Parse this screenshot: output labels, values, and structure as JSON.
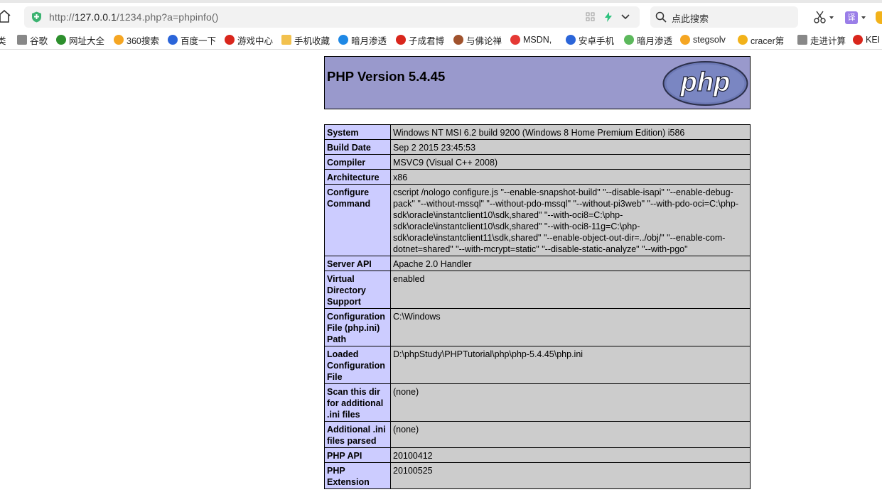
{
  "browser": {
    "url_prefix": "http://",
    "url_host": "127.0.0.1",
    "url_path": "/1234.php?a=phpinfo()",
    "search_placeholder": "点此搜索",
    "translate_label": "译"
  },
  "bookmarks": [
    {
      "label": "类",
      "icon": "folder-icon",
      "color": "#888888"
    },
    {
      "label": "谷歌",
      "icon": "page-icon",
      "color": "#888888"
    },
    {
      "label": "网址大全",
      "icon": "site-directory-icon",
      "color": "#2d8f2d"
    },
    {
      "label": "360搜索",
      "icon": "360-search-icon",
      "color": "#f5a623"
    },
    {
      "label": "百度一下",
      "icon": "baidu-paw-icon",
      "color": "#2b65d9"
    },
    {
      "label": "游戏中心",
      "icon": "game-center-icon",
      "color": "#d9261c"
    },
    {
      "label": "手机收藏",
      "icon": "folder-icon",
      "color": "#f2c14e"
    },
    {
      "label": "暗月渗透",
      "icon": "share-icon",
      "color": "#1e88e5"
    },
    {
      "label": "子成君博",
      "icon": "blog-icon",
      "color": "#d9261c"
    },
    {
      "label": "与佛论禅",
      "icon": "avatar-icon",
      "color": "#a0522d"
    },
    {
      "label": "MSDN,",
      "icon": "msdn-icon",
      "color": "#e53935"
    },
    {
      "label": "安卓手机",
      "icon": "baidu-paw-icon",
      "color": "#2b65d9"
    },
    {
      "label": "暗月渗透",
      "icon": "green-dot-icon",
      "color": "#5cb85c"
    },
    {
      "label": "stegsolv",
      "icon": "360-search-icon",
      "color": "#f5a623"
    },
    {
      "label": "cracer第",
      "icon": "crown-icon",
      "color": "#f2b21a"
    },
    {
      "label": "走进计算",
      "icon": "page-icon",
      "color": "#888888"
    },
    {
      "label": "KEI",
      "icon": "kei-icon",
      "color": "#d9261c"
    }
  ],
  "phpinfo": {
    "title": "PHP Version 5.4.45",
    "logo_text": "php",
    "rows": [
      {
        "key": "System",
        "value": "Windows NT MSI 6.2 build 9200 (Windows 8 Home Premium Edition) i586"
      },
      {
        "key": "Build Date",
        "value": "Sep 2 2015 23:45:53"
      },
      {
        "key": "Compiler",
        "value": "MSVC9 (Visual C++ 2008)"
      },
      {
        "key": "Architecture",
        "value": "x86"
      },
      {
        "key": "Configure Command",
        "value": "cscript /nologo configure.js \"--enable-snapshot-build\" \"--disable-isapi\" \"--enable-debug-pack\" \"--without-mssql\" \"--without-pdo-mssql\" \"--without-pi3web\" \"--with-pdo-oci=C:\\php-sdk\\oracle\\instantclient10\\sdk,shared\" \"--with-oci8=C:\\php-sdk\\oracle\\instantclient10\\sdk,shared\" \"--with-oci8-11g=C:\\php-sdk\\oracle\\instantclient11\\sdk,shared\" \"--enable-object-out-dir=../obj/\" \"--enable-com-dotnet=shared\" \"--with-mcrypt=static\" \"--disable-static-analyze\" \"--with-pgo\""
      },
      {
        "key": "Server API",
        "value": "Apache 2.0 Handler"
      },
      {
        "key": "Virtual Directory Support",
        "value": "enabled"
      },
      {
        "key": "Configuration File (php.ini) Path",
        "value": "C:\\Windows"
      },
      {
        "key": "Loaded Configuration File",
        "value": "D:\\phpStudy\\PHPTutorial\\php\\php-5.4.45\\php.ini"
      },
      {
        "key": "Scan this dir for additional .ini files",
        "value": "(none)"
      },
      {
        "key": "Additional .ini files parsed",
        "value": "(none)"
      },
      {
        "key": "PHP API",
        "value": "20100412"
      },
      {
        "key": "PHP Extension",
        "value": "20100525"
      }
    ]
  }
}
